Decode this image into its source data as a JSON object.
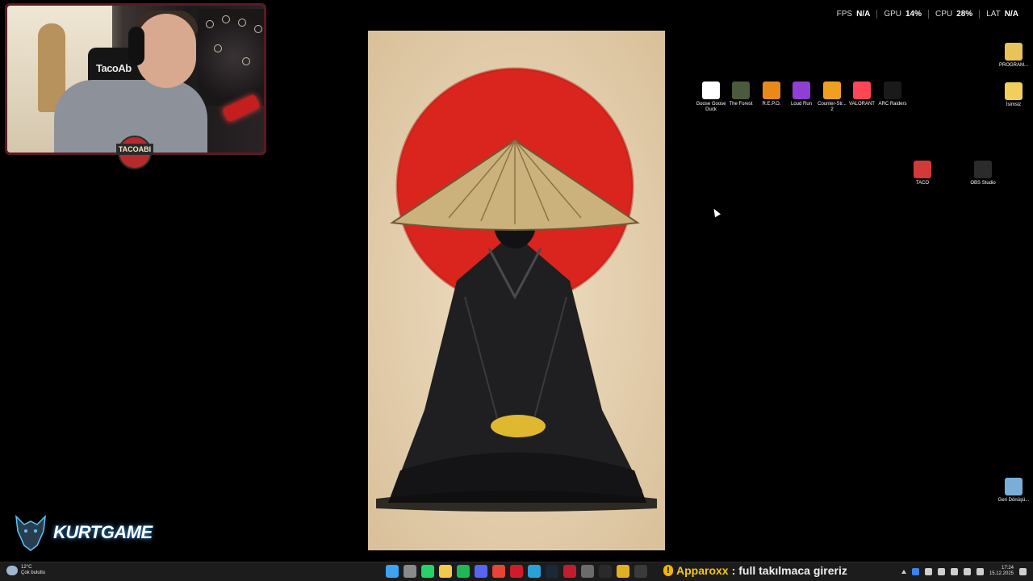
{
  "perf_overlay": {
    "fps_label": "FPS",
    "fps_value": "N/A",
    "gpu_label": "GPU",
    "gpu_value": "14%",
    "cpu_label": "CPU",
    "cpu_value": "28%",
    "lat_label": "LAT",
    "lat_value": "N/A"
  },
  "webcam": {
    "chair_text": "TacoAb",
    "badge_text": "TACOABI"
  },
  "desktop_icons": [
    {
      "label": "Goose Goose Duck",
      "icon": "goose-icon",
      "color": "#ffffff"
    },
    {
      "label": "The Forest",
      "icon": "forest-icon",
      "color": "#4b5a3a"
    },
    {
      "label": "R.E.P.O.",
      "icon": "repo-icon",
      "color": "#e88a1a"
    },
    {
      "label": "Loud Run",
      "icon": "loud-run-icon",
      "color": "#8f3fd1"
    },
    {
      "label": "Counter-Str... 2",
      "icon": "counter-strike-icon",
      "color": "#f0a020"
    },
    {
      "label": "VALORANT",
      "icon": "valorant-icon",
      "color": "#ff4655"
    },
    {
      "label": "ARC Raiders",
      "icon": "arc-raiders-icon",
      "color": "#1a1a1a"
    }
  ],
  "right_icons": [
    {
      "label": "PROGRAM...",
      "icon": "folder-icon",
      "color": "#e8c25a"
    },
    {
      "label": "İsimsiz",
      "icon": "folder-icon",
      "color": "#f2cf5b"
    }
  ],
  "app_icons": [
    {
      "label": "TACO",
      "icon": "power-icon",
      "color": "#d23a3a"
    },
    {
      "label": "OBS Studio",
      "icon": "obs-icon",
      "color": "#2b2b2b"
    }
  ],
  "recycle_bin": {
    "label": "Geri Dönüşü...",
    "icon": "recycle-bin-icon"
  },
  "logo": {
    "text": "KURTGAME"
  },
  "taskbar": {
    "weather_temp": "12°C",
    "weather_desc": "Çok bulutlu",
    "apps": [
      {
        "name": "windows-start-icon",
        "color": "#3ea2f2"
      },
      {
        "name": "task-view-icon",
        "color": "#8a8a8a"
      },
      {
        "name": "whatsapp-icon",
        "color": "#25d366"
      },
      {
        "name": "file-explorer-icon",
        "color": "#f2c94c"
      },
      {
        "name": "spotify-icon",
        "color": "#1db954"
      },
      {
        "name": "discord-icon",
        "color": "#5865f2"
      },
      {
        "name": "chrome-icon",
        "color": "#e84335"
      },
      {
        "name": "opera-icon",
        "color": "#d11a2a"
      },
      {
        "name": "edge-icon",
        "color": "#2b9fd9"
      },
      {
        "name": "steam-icon",
        "color": "#1b2838"
      },
      {
        "name": "app-red-icon",
        "color": "#c21c2e"
      },
      {
        "name": "app-gear-icon",
        "color": "#6b6b6b"
      },
      {
        "name": "app-black-icon",
        "color": "#2a2a2a"
      },
      {
        "name": "app-yellow-icon",
        "color": "#e0b020"
      },
      {
        "name": "obs-taskbar-icon",
        "color": "#3a3a3a"
      }
    ],
    "chat_user": "Apparoxx",
    "chat_sep": " : ",
    "chat_message": "full takılmaca gireriz",
    "time": "17:24",
    "date": "15.12.2025"
  }
}
